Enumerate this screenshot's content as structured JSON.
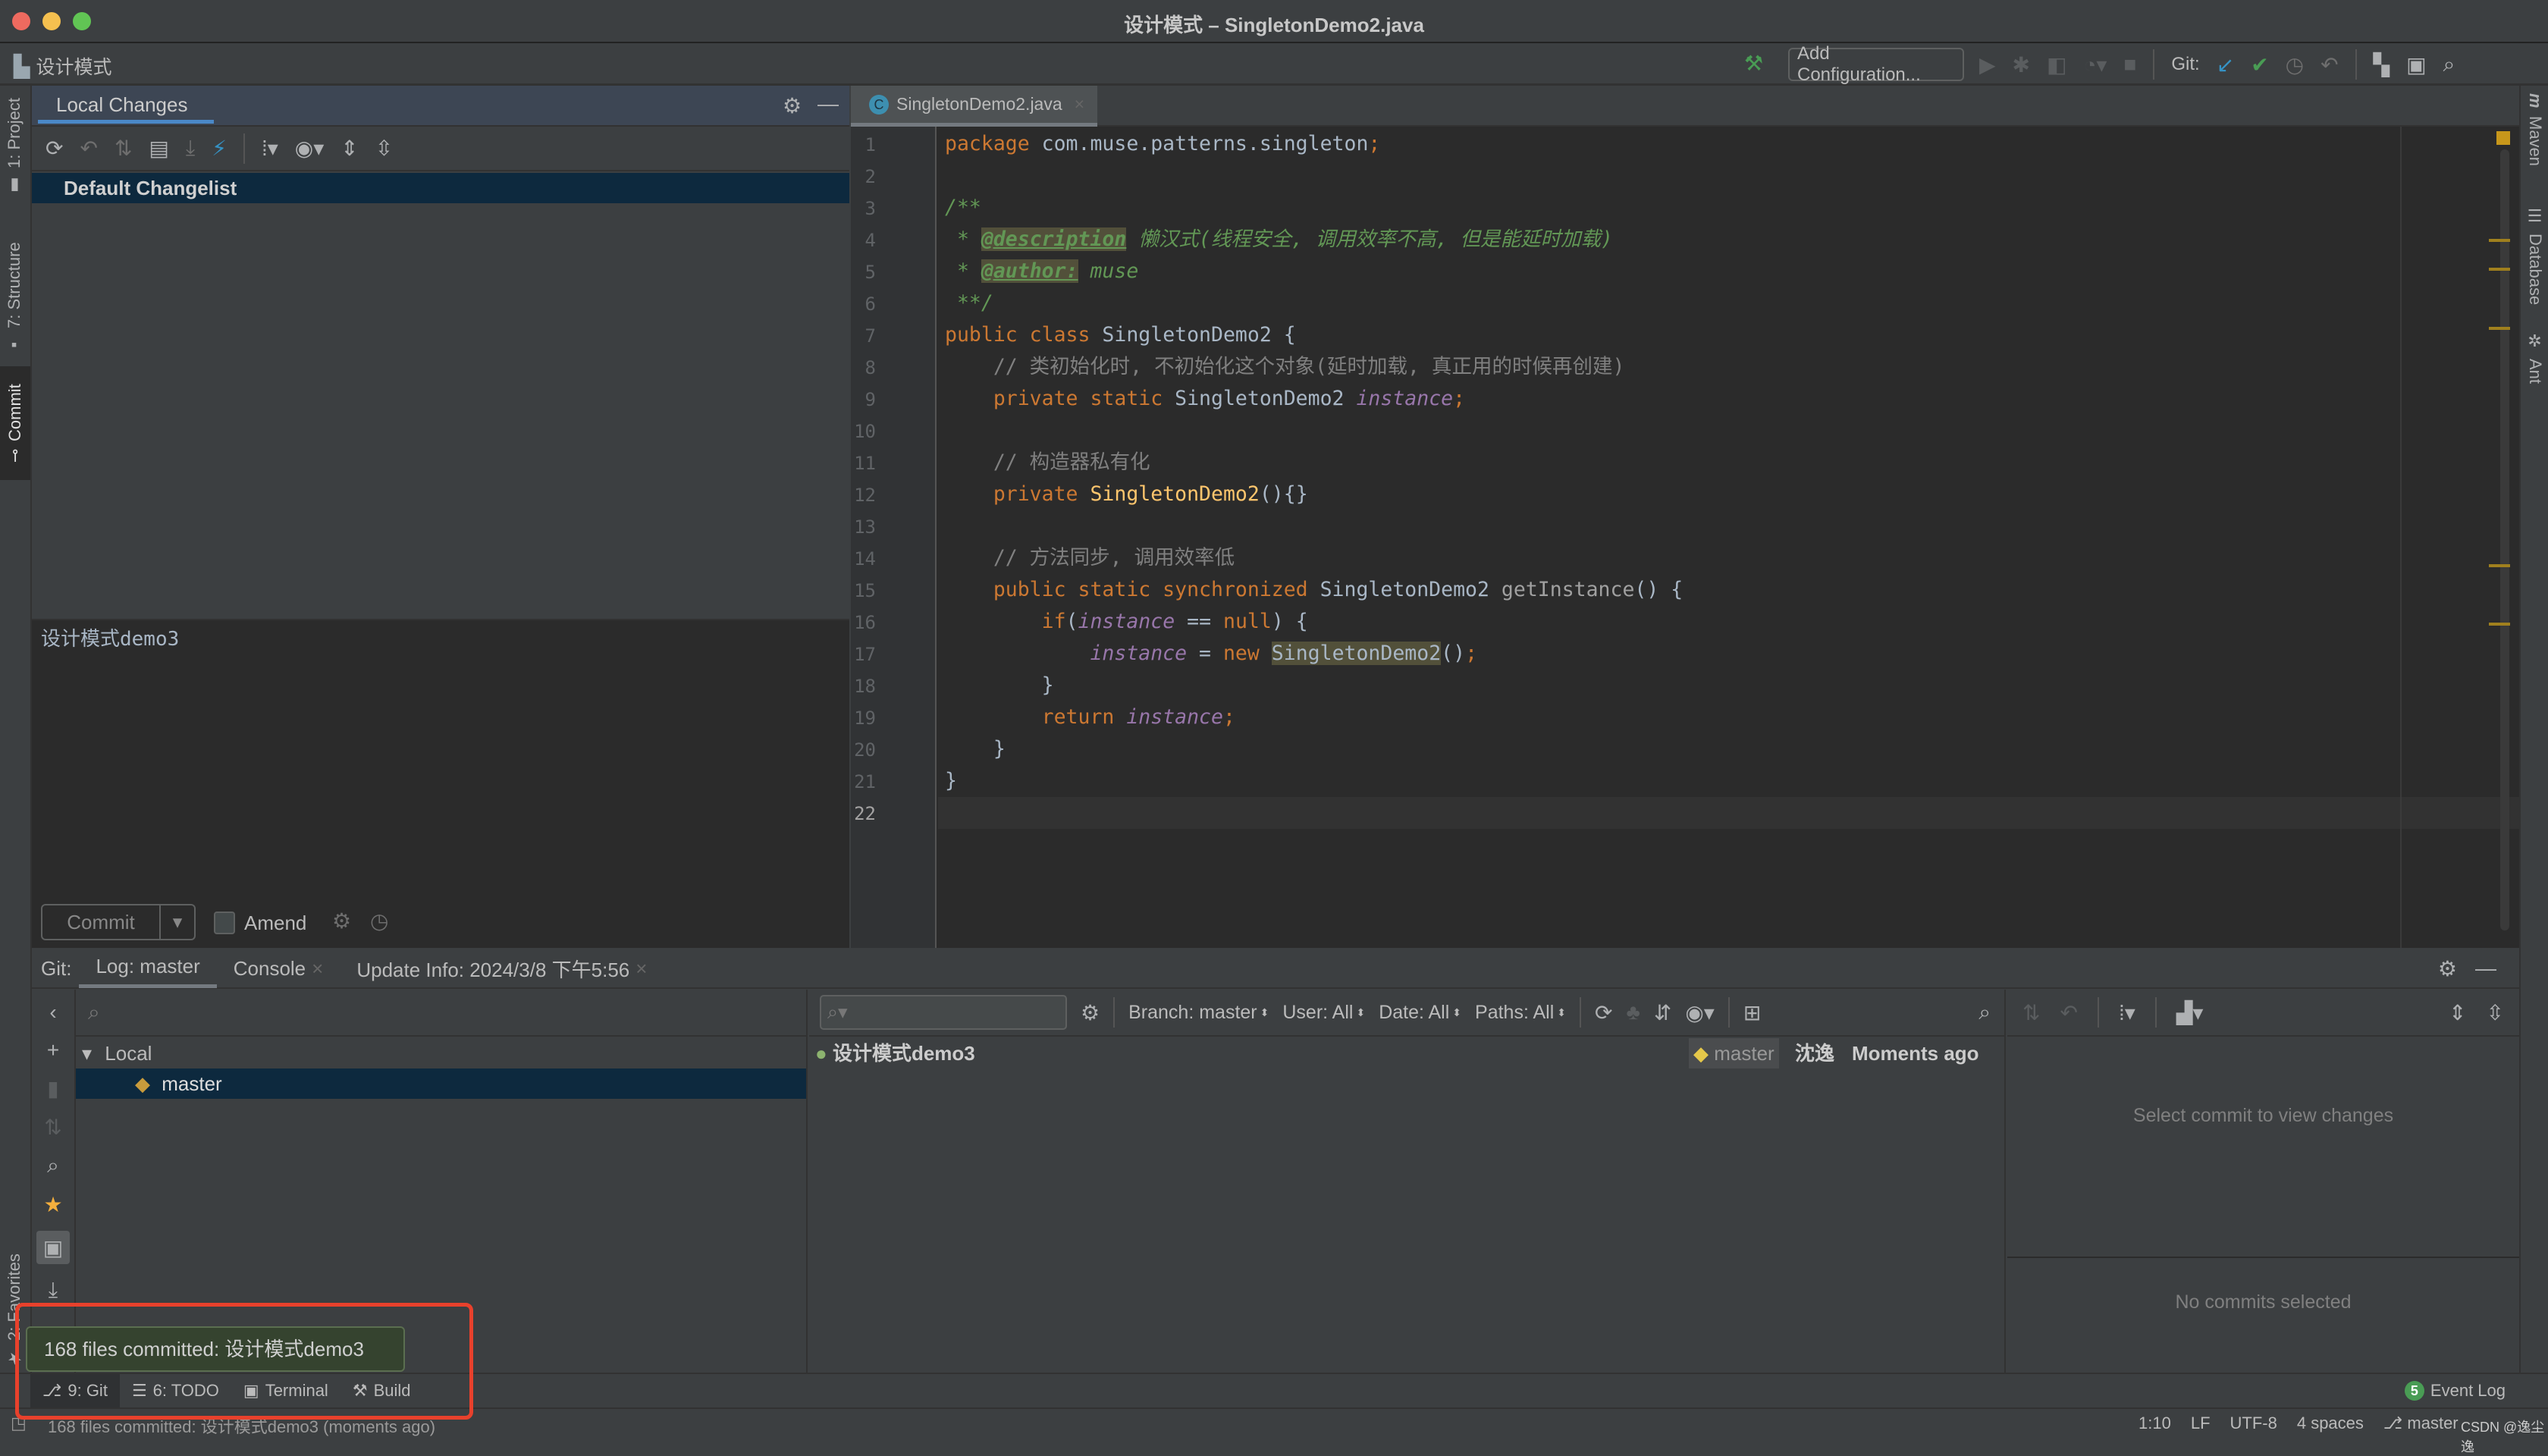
{
  "window": {
    "title": "设计模式 – SingletonDemo2.java"
  },
  "navbar": {
    "project": "设计模式",
    "add_configuration": "Add Configuration...",
    "git_label": "Git:"
  },
  "left_stripe": {
    "project": "1: Project",
    "structure": "7: Structure",
    "commit": "Commit",
    "favorites": "2: Favorites"
  },
  "right_stripe": {
    "maven": "Maven",
    "database": "Database",
    "ant": "Ant"
  },
  "local_changes": {
    "tab": "Local Changes",
    "changelist": "Default Changelist",
    "message": "设计模式demo3",
    "commit_button": "Commit",
    "amend_label": "Amend",
    "amend_checked": false
  },
  "editor": {
    "tab": "SingletonDemo2.java",
    "current_line": 22,
    "lines": [
      [
        [
          "kw",
          "package "
        ],
        [
          "pl",
          "com.muse.patterns.singleton"
        ],
        [
          "kw",
          ";"
        ]
      ],
      [],
      [
        [
          "doc",
          "/**"
        ]
      ],
      [
        [
          "doc",
          " * "
        ],
        [
          "tag",
          "@description"
        ],
        [
          "doc",
          " 懒汉式(线程安全, 调用效率不高, 但是能延时加载)"
        ]
      ],
      [
        [
          "doc",
          " * "
        ],
        [
          "tag",
          "@author:"
        ],
        [
          "doc",
          " muse"
        ]
      ],
      [
        [
          "doc",
          " **/"
        ]
      ],
      [
        [
          "kw",
          "public class "
        ],
        [
          "pl",
          "SingletonDemo2 {"
        ]
      ],
      [
        [
          "cm",
          "    // 类初始化时, 不初始化这个对象(延时加载, 真正用的时候再创建)"
        ]
      ],
      [
        [
          "kw",
          "    private static "
        ],
        [
          "pl",
          "SingletonDemo2 "
        ],
        [
          "fld",
          "instance"
        ],
        [
          "kw",
          ";"
        ]
      ],
      [],
      [
        [
          "cm",
          "    // 构造器私有化"
        ]
      ],
      [
        [
          "kw",
          "    private "
        ],
        [
          "fn",
          "SingletonDemo2"
        ],
        [
          "pl",
          "(){}"
        ]
      ],
      [],
      [
        [
          "cm",
          "    // 方法同步, 调用效率低"
        ]
      ],
      [
        [
          "kw",
          "    public static synchronized "
        ],
        [
          "pl",
          "SingletonDemo2 "
        ],
        [
          "call",
          "getInstance"
        ],
        [
          "pl",
          "() {"
        ]
      ],
      [
        [
          "kw",
          "        if"
        ],
        [
          "pl",
          "("
        ],
        [
          "fld",
          "instance"
        ],
        [
          "pl",
          " == "
        ],
        [
          "kw",
          "null"
        ],
        [
          "pl",
          ") {"
        ]
      ],
      [
        [
          "fld",
          "            instance"
        ],
        [
          "pl",
          " = "
        ],
        [
          "kw",
          "new "
        ],
        [
          "hl",
          "SingletonDemo2"
        ],
        [
          "pl",
          "()"
        ],
        [
          "kw",
          ";"
        ]
      ],
      [
        [
          "pl",
          "        }"
        ]
      ],
      [
        [
          "kw",
          "        return "
        ],
        [
          "fld",
          "instance"
        ],
        [
          "kw",
          ";"
        ]
      ],
      [
        [
          "pl",
          "    }"
        ]
      ],
      [
        [
          "pl",
          "}"
        ]
      ],
      []
    ]
  },
  "git_panel": {
    "prefix": "Git:",
    "tabs": [
      {
        "label": "Log: master",
        "active": true
      },
      {
        "label": "Console",
        "closable": true
      },
      {
        "label": "Update Info: 2024/3/8 下午5:56",
        "closable": true
      }
    ],
    "branches": {
      "group": "Local",
      "selected": "master"
    },
    "filters": {
      "branch": "Branch: master",
      "user": "User: All",
      "date": "Date: All",
      "paths": "Paths: All"
    },
    "commits": [
      {
        "message": "设计模式demo3",
        "ref": "master",
        "author": "沈逸",
        "date": "Moments ago"
      }
    ],
    "details_empty": "Select commit to view changes",
    "no_commits": "No commits selected"
  },
  "tool_buttons": {
    "git": "9: Git",
    "todo": "6: TODO",
    "terminal": "Terminal",
    "build": "Build",
    "event_log": "Event Log",
    "event_count": "5"
  },
  "notification": "168 files committed: 设计模式demo3",
  "status_bar": {
    "message": "168 files committed: 设计模式demo3 (moments ago)",
    "position": "1:10",
    "line_sep": "LF",
    "encoding": "UTF-8",
    "indent": "4 spaces",
    "branch": "master",
    "watermark": "CSDN @逸尘逸"
  },
  "colors": {
    "keyword": "#cc7832",
    "doc": "#629755",
    "field": "#9876aa",
    "method": "#ffc66d",
    "selection": "#0d293e",
    "highlight_box": "#e8412c"
  }
}
